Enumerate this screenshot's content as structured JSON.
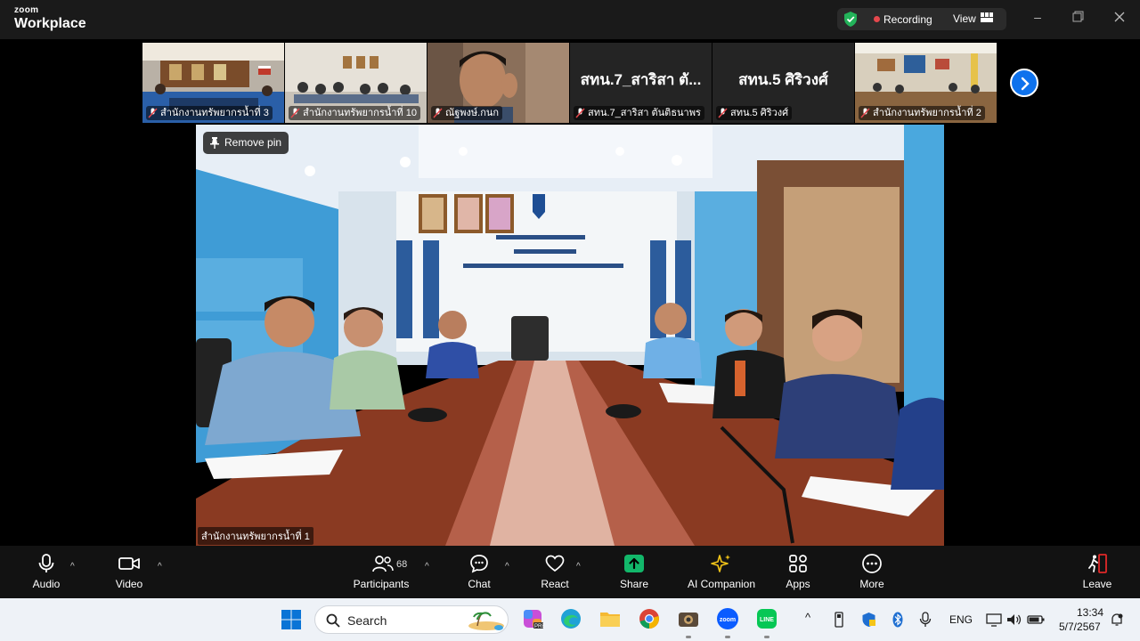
{
  "titlebar": {
    "brand_top": "zoom",
    "brand_bottom": "Workplace",
    "recording_label": "Recording",
    "view_label": "View"
  },
  "thumbnails": [
    {
      "name": "สำนักงานทรัพยากรน้ำที่ 3",
      "type": "video"
    },
    {
      "name": "สำนักงานทรัพยากรน้ำที่ 10",
      "type": "video"
    },
    {
      "name": "ณัฐพงษ์.กนก",
      "type": "video"
    },
    {
      "name": "สทน.7_สาริสา ตันติธนาพร",
      "display": "สทน.7_สาริสา ตั...",
      "type": "avatar"
    },
    {
      "name": "สทน.5 ศิริวงศ์",
      "display": "สทน.5 ศิริวงศ์",
      "type": "avatar"
    },
    {
      "name": "สำนักงานทรัพยากรน้ำที่ 2",
      "type": "video"
    }
  ],
  "main_video": {
    "pin_label": "Remove pin",
    "participant_name": "สำนักงานทรัพยากรน้ำที่ 1"
  },
  "toolbar": {
    "audio": "Audio",
    "video": "Video",
    "participants": "Participants",
    "participant_count": "68",
    "chat": "Chat",
    "react": "React",
    "share": "Share",
    "ai_companion": "AI Companion",
    "apps": "Apps",
    "more": "More",
    "leave": "Leave"
  },
  "taskbar": {
    "search_label": "Search",
    "language": "ENG",
    "time": "13:34",
    "date": "5/7/2567"
  },
  "colors": {
    "accent": "#0e72ed",
    "share_green": "#12b76a",
    "record_red": "#e5484d",
    "leave_red": "#e02828"
  }
}
